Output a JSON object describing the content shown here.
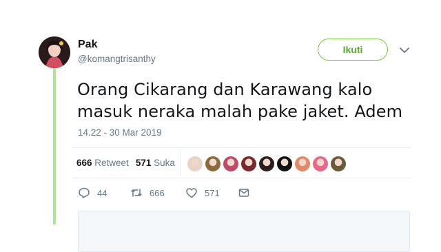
{
  "user": {
    "name": "Pak",
    "handle": "@komangtrisanthy"
  },
  "follow_label": "Ikuti",
  "tweet": {
    "line1": "Orang Cikarang dan Karawang kalo",
    "line2": "masuk neraka malah pake jaket. Adem",
    "timestamp": "14.22 - 30 Mar 2019"
  },
  "stats": {
    "retweets": "666",
    "retweet_label": "Retweet",
    "likes": "571",
    "like_label": "Suka"
  },
  "likers": [
    {
      "color": "#e9d3c6"
    },
    {
      "color": "#8a6a3a"
    },
    {
      "color": "#c04a6a"
    },
    {
      "color": "#7a2a2a"
    },
    {
      "color": "#2b1e1e"
    },
    {
      "color": "#111111"
    },
    {
      "color": "#e2896a"
    },
    {
      "color": "#e8688a"
    },
    {
      "color": "#6a5a3a"
    }
  ],
  "actions": {
    "replies": "44",
    "retweets": "666",
    "likes": "571"
  },
  "colors": {
    "accent": "#7ac143",
    "muted": "#657786",
    "thread": "#b3e49a"
  }
}
